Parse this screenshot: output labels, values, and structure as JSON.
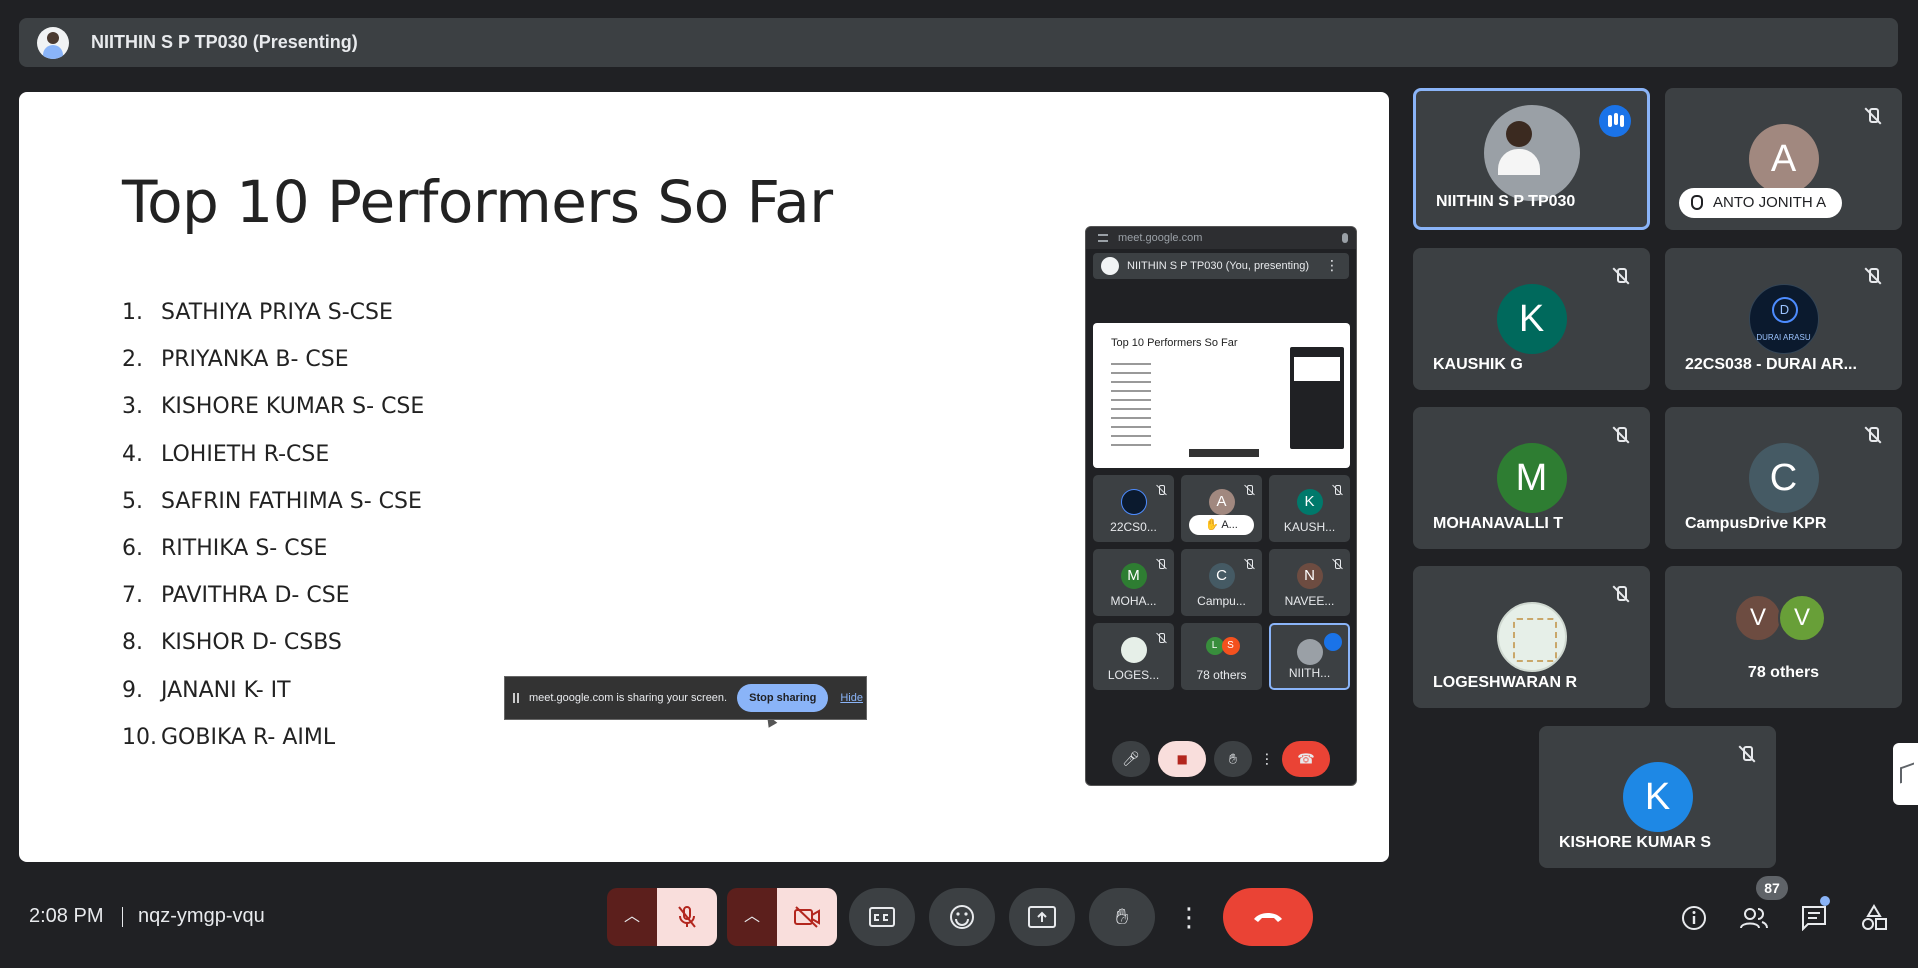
{
  "presenter_bar": {
    "name": "NIITHIN S P TP030 (Presenting)"
  },
  "slide": {
    "title": "Top 10 Performers So Far",
    "items": [
      {
        "num": "1.",
        "text": "SATHIYA PRIYA S-CSE"
      },
      {
        "num": "2.",
        "text": "PRIYANKA B- CSE"
      },
      {
        "num": "3.",
        "text": "KISHORE KUMAR S- CSE"
      },
      {
        "num": "4.",
        "text": "LOHIETH R-CSE"
      },
      {
        "num": "5.",
        "text": "SAFRIN FATHIMA S- CSE"
      },
      {
        "num": "6.",
        "text": "RITHIKA S- CSE"
      },
      {
        "num": "7.",
        "text": "PAVITHRA D- CSE"
      },
      {
        "num": "8.",
        "text": "KISHOR D- CSBS"
      },
      {
        "num": "9.",
        "text": "JANANI K- IT"
      },
      {
        "num": "10.",
        "text": "GOBIKA R- AIML"
      }
    ]
  },
  "share_notice": {
    "text": "meet.google.com is sharing your screen.",
    "stop_label": "Stop sharing",
    "hide_label": "Hide"
  },
  "mini_window": {
    "url": "meet.google.com",
    "presenter": "NIITHIN S P TP030 (You, presenting)",
    "slide_title": "Top 10 Performers So Far",
    "tiles": [
      {
        "initial": "",
        "label": "22CS0...",
        "color": "#0b1a2e"
      },
      {
        "initial": "A",
        "label": "A...",
        "color": "#a1887f"
      },
      {
        "initial": "K",
        "label": "KAUSH...",
        "color": "#00796b"
      },
      {
        "initial": "M",
        "label": "MOHA...",
        "color": "#2e7d32"
      },
      {
        "initial": "C",
        "label": "Campu...",
        "color": "#455a64"
      },
      {
        "initial": "N",
        "label": "NAVEE...",
        "color": "#6d4c41"
      },
      {
        "initial": "",
        "label": "LOGES...",
        "color": "#e6efe8"
      },
      {
        "initial": "L",
        "label": "78 others",
        "color": "#388e3c"
      },
      {
        "initial": "",
        "label": "NIITH...",
        "color": "#9aa0a6"
      }
    ]
  },
  "participants": [
    {
      "name": "NIITHIN S P TP030",
      "initial": "",
      "color": "#9aa0a6",
      "speaking": true
    },
    {
      "name": "ANTO JONITH A",
      "initial": "A",
      "color": "#a1887f",
      "hand_raised": true
    },
    {
      "name": "KAUSHIK G",
      "initial": "K",
      "color": "#00695c"
    },
    {
      "name": "22CS038 - DURAI AR...",
      "initial": "D",
      "logo_text": "DURAI ARASU",
      "color": "#0b1a2e"
    },
    {
      "name": "MOHANAVALLI T",
      "initial": "M",
      "color": "#2e7d32"
    },
    {
      "name": "CampusDrive KPR",
      "initial": "C",
      "color": "#455a64"
    },
    {
      "name": "LOGESHWARAN R",
      "initial": "",
      "color": "#e6efe8"
    },
    {
      "name": "78 others",
      "avatars": [
        {
          "initial": "V",
          "color": "#6d4c41"
        },
        {
          "initial": "V",
          "color": "#689f38"
        }
      ]
    },
    {
      "name": "KISHORE KUMAR S",
      "initial": "K",
      "color": "#1e88e5"
    }
  ],
  "bottom_bar": {
    "time": "2:08 PM",
    "meeting_code": "nqz-ymgp-vqu",
    "people_count": "87"
  },
  "colors": {
    "background": "#202124",
    "tile": "#3c4043",
    "accent": "#8ab4f8",
    "end_call": "#ea4335",
    "muted_bg": "#f9dedc"
  },
  "icons": {
    "controls": [
      "chevron-up-icon",
      "mic-off-icon",
      "chevron-up-icon",
      "camera-off-icon",
      "captions-icon",
      "emoji-icon",
      "present-icon",
      "raise-hand-icon",
      "more-vert-icon",
      "end-call-icon"
    ],
    "right": [
      "info-icon",
      "people-icon",
      "chat-icon",
      "activities-icon"
    ]
  }
}
